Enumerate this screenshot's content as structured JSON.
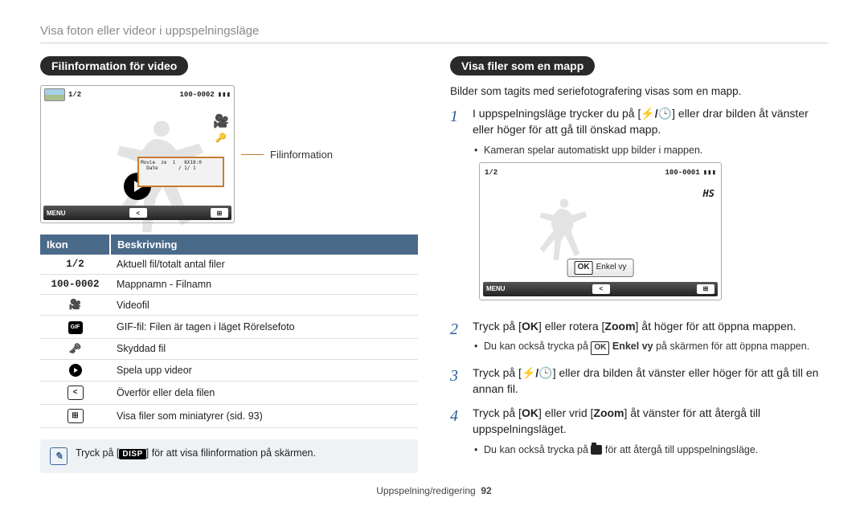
{
  "chapter": "Visa foton eller videor i uppspelningsläge",
  "left": {
    "heading": "Filinformation för video",
    "lcd": {
      "counter": "1/2",
      "folder": "100-0002",
      "menu_label": "MENU"
    },
    "callout": "Filinformation",
    "table": {
      "head_icon": "Ikon",
      "head_desc": "Beskrivning",
      "rows": [
        {
          "icon": "1/2",
          "mono": true,
          "desc": "Aktuell fil/totalt antal filer"
        },
        {
          "icon": "100-0002",
          "mono": true,
          "desc": "Mappnamn - Filnamn"
        },
        {
          "icon": "video",
          "desc": "Videofil"
        },
        {
          "icon": "gif",
          "desc": "GIF-fil: Filen är tagen i läget Rörelsefoto"
        },
        {
          "icon": "key",
          "desc": "Skyddad fil"
        },
        {
          "icon": "play",
          "desc": "Spela upp videor"
        },
        {
          "icon": "share",
          "desc": "Överför eller dela filen"
        },
        {
          "icon": "grid",
          "desc": "Visa filer som miniatyrer (sid. 93)"
        }
      ]
    },
    "note_pre": "Tryck på [",
    "note_disp": "DISP",
    "note_post": "] för att visa filinformation på skärmen."
  },
  "right": {
    "heading": "Visa filer som en mapp",
    "intro": "Bilder som tagits med seriefotografering visas som en mapp.",
    "steps": [
      {
        "n": "1",
        "text_pre": "I uppspelningsläge trycker du på [",
        "text_mid": "] eller drar bilden åt vänster eller höger för att gå till önskad mapp.",
        "sub": [
          "Kameran spelar automatiskt upp bilder i mappen."
        ]
      },
      {
        "n": "2",
        "text_pre": "Tryck på [",
        "ok": true,
        "text_mid": "] eller rotera [",
        "zoom": "Zoom",
        "text_post": "] åt höger för att öppna mappen.",
        "sub_pre": "Du kan också trycka på ",
        "sub_ok": "OK",
        "sub_bold": " Enkel vy",
        "sub_post": " på skärmen för att öppna mappen."
      },
      {
        "n": "3",
        "text_pre": "Tryck på [",
        "text_mid": "] eller dra bilden åt vänster eller höger för att gå till en annan fil."
      },
      {
        "n": "4",
        "text_pre": "Tryck på [",
        "ok": true,
        "text_mid": "] eller vrid [",
        "zoom": "Zoom",
        "text_post": "] åt vänster för att återgå till uppspelningsläget.",
        "sub_pre": "Du kan också trycka på ",
        "sub_folder": true,
        "sub_post": " för att återgå till uppspelningsläge."
      }
    ],
    "lcd": {
      "counter": "1/2",
      "folder": "100-0001",
      "hs": "HS",
      "ok": "OK",
      "ok_label": "Enkel vy",
      "menu_label": "MENU"
    }
  },
  "footer": {
    "section": "Uppspelning/redigering",
    "page": "92"
  }
}
